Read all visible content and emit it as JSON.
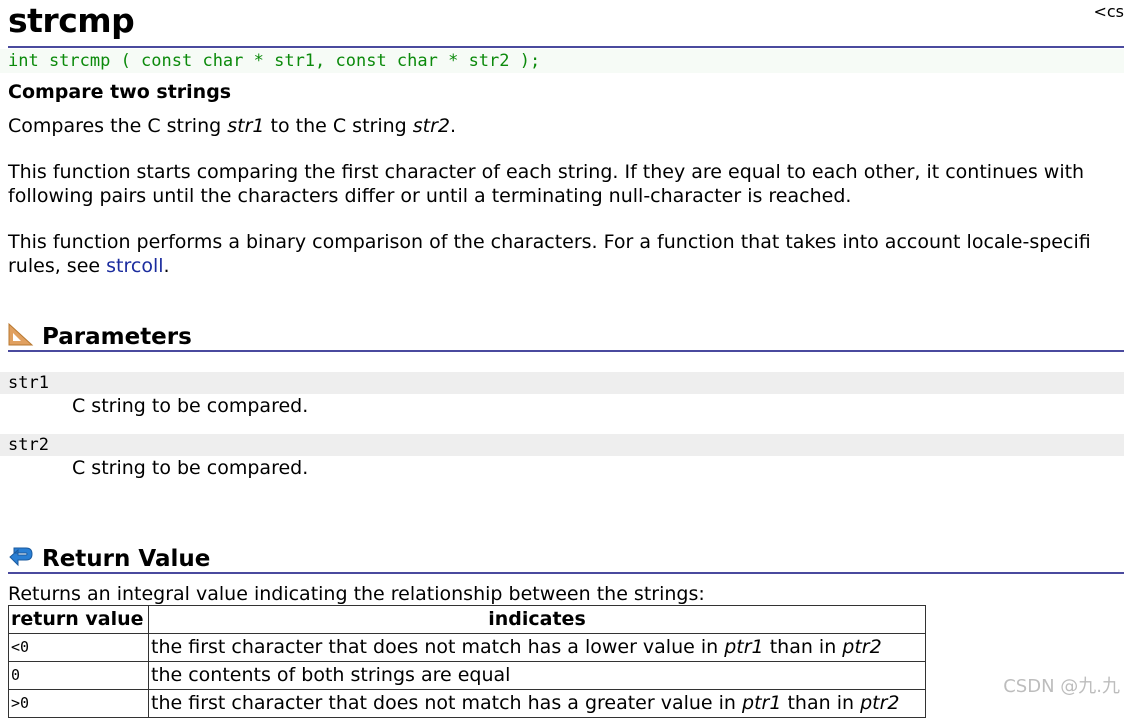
{
  "page": {
    "title": "strcmp",
    "cs_tag": "<cs",
    "prototype": "int strcmp ( const char * str1, const char * str2 );",
    "subtitle": "Compare two strings",
    "intro": {
      "p1_a": "Compares the C string ",
      "p1_b": "str1",
      "p1_c": " to the C string ",
      "p1_d": "str2",
      "p1_e": ".",
      "p2_l1": "This function starts comparing the first character of each string. If they are equal to each other, it continues with",
      "p2_l2": "following pairs until the characters differ or until a terminating null-character is reached.",
      "p3_l1": "This function performs a binary comparison of the characters. For a function that takes into account locale-specifi",
      "p3_l2a": "rules, see ",
      "p3_link": "strcoll",
      "p3_l2b": "."
    }
  },
  "parameters": {
    "heading": "Parameters",
    "items": [
      {
        "name": "str1",
        "desc": "C string to be compared."
      },
      {
        "name": "str2",
        "desc": "C string to be compared."
      }
    ]
  },
  "return_value": {
    "heading": "Return Value",
    "intro": "Returns an integral value indicating the relationship between the strings:",
    "table": {
      "headers": [
        "return value",
        "indicates"
      ],
      "rows": [
        {
          "value": "<0",
          "a": "the first character that does not match has a lower value in ",
          "b": "ptr1",
          "c": " than in ",
          "d": "ptr2"
        },
        {
          "value": "0",
          "a": "the contents of both strings are equal",
          "b": "",
          "c": "",
          "d": ""
        },
        {
          "value": ">0",
          "a": "the first character that does not match has a greater value in ",
          "b": "ptr1",
          "c": " than in ",
          "d": "ptr2"
        }
      ]
    }
  },
  "watermark": "CSDN @九.九",
  "colors": {
    "accent_rule": "#4a4a9e",
    "prototype_text": "#0b8a0b",
    "link": "#1b2c9e",
    "params_icon": "#e0a060",
    "return_icon": "#2a7fd4"
  }
}
